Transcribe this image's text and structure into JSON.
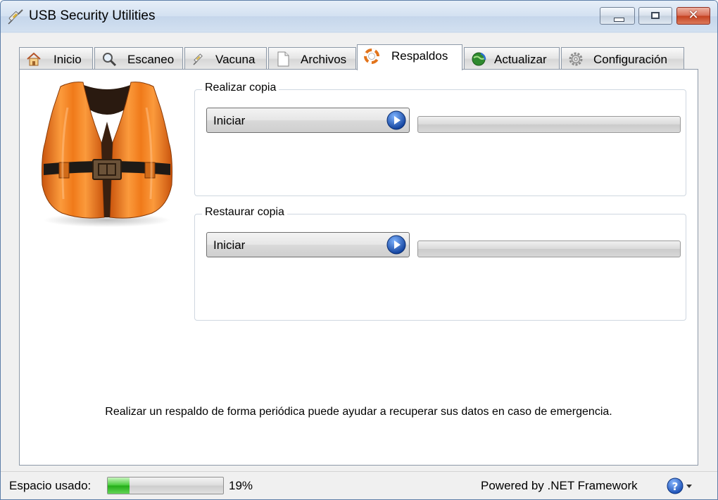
{
  "window": {
    "title": "USB Security Utilities",
    "controls": {
      "minimize": "minimize",
      "maximize": "maximize",
      "close": "✕"
    }
  },
  "tabs": [
    {
      "label": "Inicio",
      "icon": "home-icon"
    },
    {
      "label": "Escaneo",
      "icon": "magnifier-icon"
    },
    {
      "label": "Vacuna",
      "icon": "syringe-icon"
    },
    {
      "label": "Archivos",
      "icon": "document-icon"
    },
    {
      "label": "Respaldos",
      "icon": "lifebuoy-icon",
      "active": true
    },
    {
      "label": "Actualizar",
      "icon": "globe-update-icon"
    },
    {
      "label": "Configuración",
      "icon": "gear-icon"
    }
  ],
  "backup": {
    "legend": "Realizar copia",
    "button_label": "Iniciar",
    "progress": 0
  },
  "restore": {
    "legend": "Restaurar copia",
    "button_label": "Iniciar",
    "progress": 0
  },
  "message": "Realizar un respaldo de forma periódica puede ayudar a recuperar sus datos en caso de emergencia.",
  "status": {
    "space_label": "Espacio usado:",
    "space_used_percent": 19,
    "space_used_text": "19%",
    "powered_by": "Powered by .NET Framework"
  },
  "colors": {
    "vest": "#f07a1a",
    "progress_green": "#2fb524",
    "play_blue": "#1f5fc7",
    "window_frame": "#5d7ea8"
  }
}
